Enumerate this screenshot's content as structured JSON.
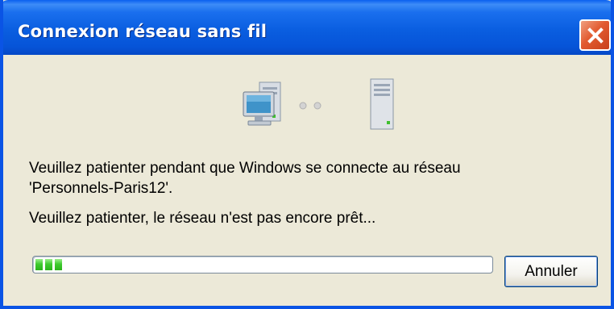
{
  "window": {
    "title": "Connexion réseau sans fil"
  },
  "dialog": {
    "message_line1": "Veuillez patienter pendant que Windows se connecte au réseau",
    "message_line2": "'Personnels-Paris12'.",
    "status_text": "Veuillez patienter, le réseau n'est pas encore prêt...",
    "progress_blocks": 3,
    "cancel_label": "Annuler"
  },
  "icons": [
    "computer-icon",
    "connection-dots-icon",
    "server-icon",
    "close-icon"
  ],
  "colors": {
    "titlebar": "#0a5ee0",
    "window_bg": "#ece9d8",
    "close_button": "#e25b30",
    "progress_green": "#3fcb2f"
  }
}
